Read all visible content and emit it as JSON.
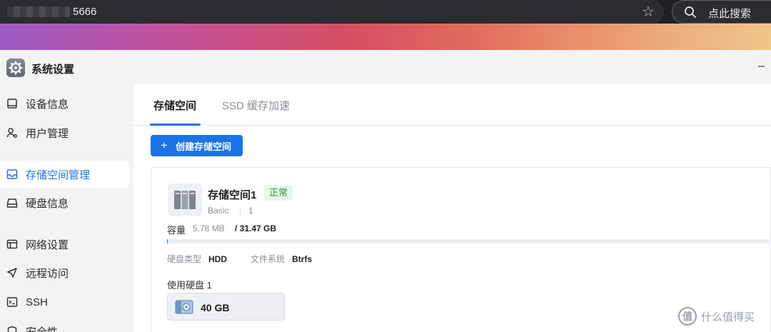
{
  "browser": {
    "url_suffix": "5666",
    "search_placeholder": "点此搜索"
  },
  "window": {
    "title": "系统设置",
    "minimize": "–"
  },
  "sidebar": {
    "items": [
      {
        "label": "设备信息",
        "icon": "device-icon",
        "active": false
      },
      {
        "label": "用户管理",
        "icon": "user-icon",
        "active": false
      },
      {
        "label": "存储空间管理",
        "icon": "storage-icon",
        "active": true
      },
      {
        "label": "硬盘信息",
        "icon": "disk-icon",
        "active": false
      },
      {
        "label": "网络设置",
        "icon": "network-icon",
        "active": false
      },
      {
        "label": "远程访问",
        "icon": "remote-access-icon",
        "active": false
      },
      {
        "label": "SSH",
        "icon": "terminal-icon",
        "active": false
      },
      {
        "label": "安全性",
        "icon": "shield-icon",
        "active": false
      }
    ]
  },
  "tabs": [
    {
      "label": "存储空间",
      "active": true
    },
    {
      "label": "SSD 缓存加速",
      "active": false
    }
  ],
  "actions": {
    "create_label": "创建存储空间"
  },
  "pool": {
    "name": "存储空间1",
    "status": "正常",
    "raid_type": "Basic",
    "disk_count": "1",
    "capacity_label": "容量",
    "used": "5.78 MB",
    "total": "/ 31.47 GB",
    "usage_fraction": 0.0002,
    "disk_type_label": "硬盘类型",
    "disk_type": "HDD",
    "filesystem_label": "文件系统",
    "filesystem": "Btrfs",
    "disks_label": "使用硬盘 1",
    "disks": [
      {
        "size": "40 GB"
      }
    ]
  },
  "watermark": {
    "logo": "值",
    "text": "什么值得买"
  },
  "colors": {
    "accent": "#1a73e8",
    "status_ok": "#2e9b45"
  }
}
